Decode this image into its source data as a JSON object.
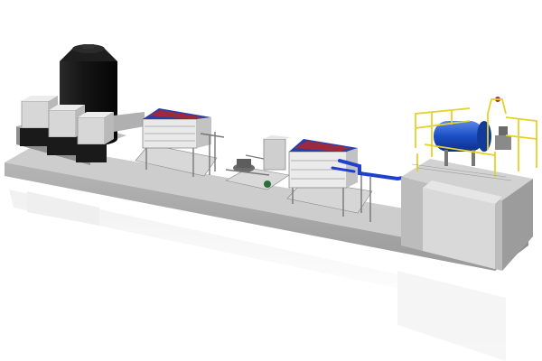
{
  "scene": {
    "subject": "industrial-process-skid-render",
    "background_color": "#ffffff",
    "colors": {
      "slab_top": "#cfcfcf",
      "slab_side": "#9c9c9c",
      "slab_front": "#b3b3b3",
      "tank": "#121212",
      "ibc": "#d6d6d6",
      "frame": "#e6e6e6",
      "filter_blue": "#2a3fa8",
      "filter_red": "#b0262c",
      "pipe_blue": "#1e3fd0",
      "vessel_blue": "#1a4fc4",
      "rail_yellow": "#e3d22a",
      "wall": "#bdbdbd"
    }
  }
}
